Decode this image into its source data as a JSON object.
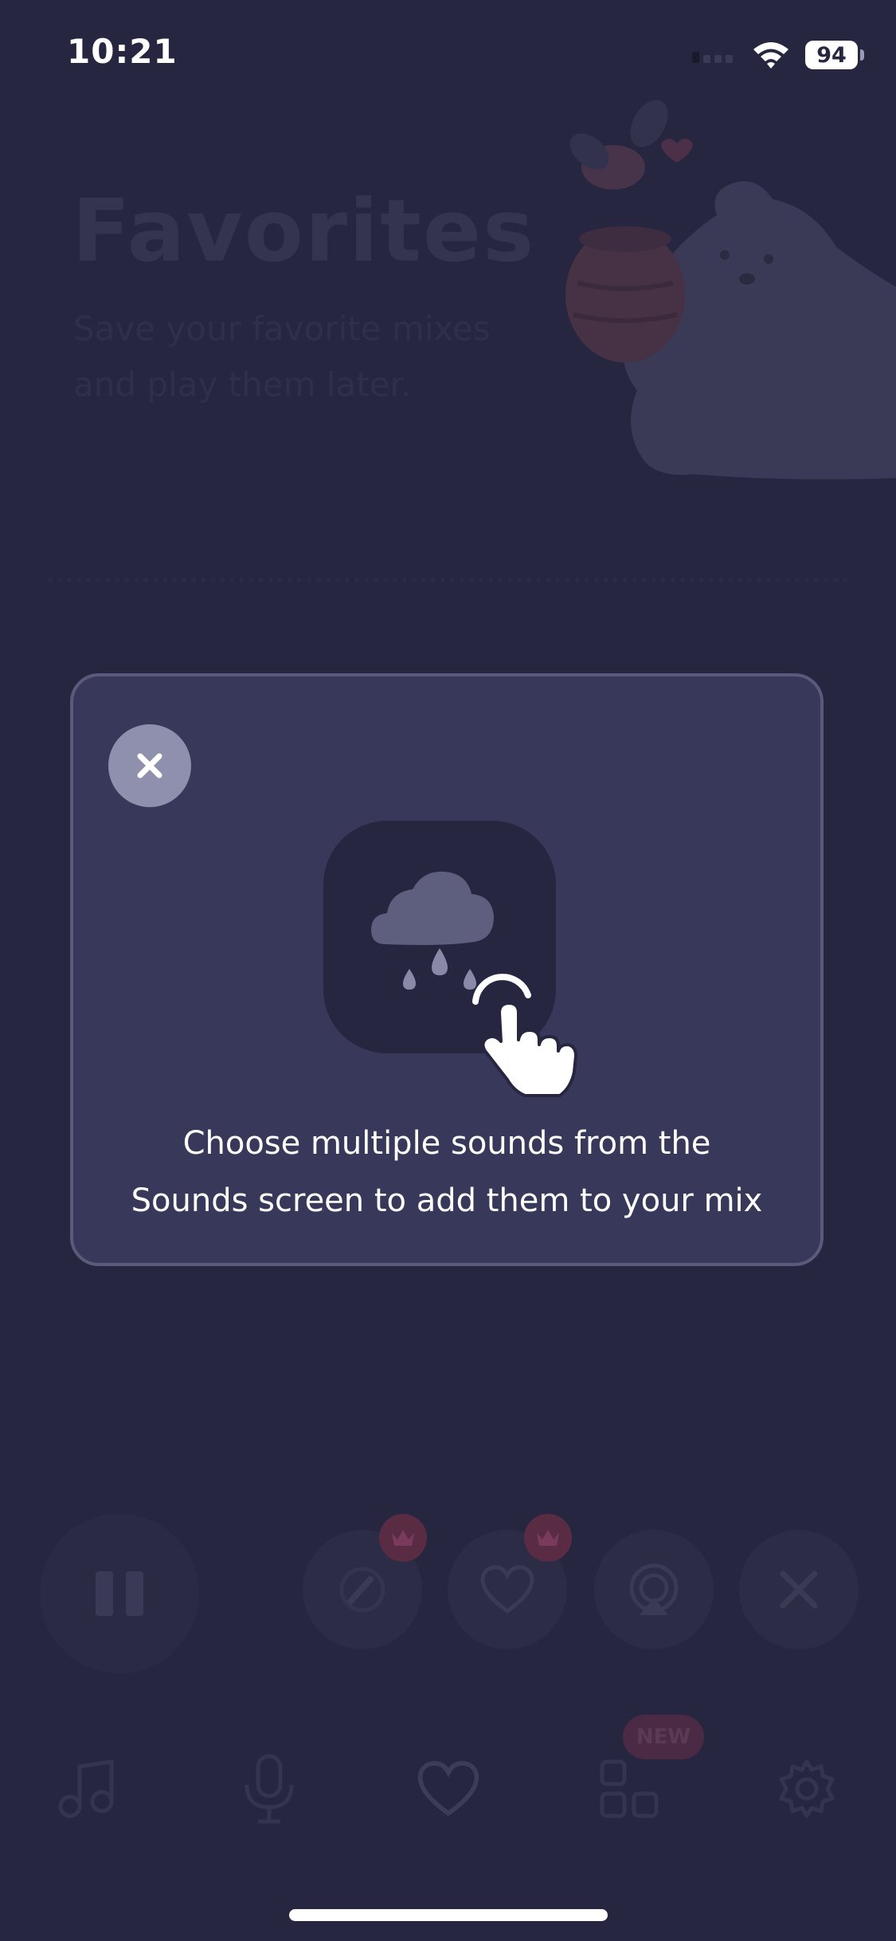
{
  "status_bar": {
    "time": "10:21",
    "battery_level": "94"
  },
  "header": {
    "title": "Favorites",
    "subtitle_line1": "Save your favorite mixes",
    "subtitle_line2": "and play them later."
  },
  "tab_bar": {
    "new_badge": "NEW"
  },
  "tip_modal": {
    "message_line1": "Choose multiple sounds from the",
    "message_line2": "Sounds screen to add them to your mix"
  },
  "colors": {
    "background": "#262640",
    "modal_background": "#38385a",
    "modal_border": "#5a5a7c",
    "close_button": "#8f8fae",
    "text": "#ffffff"
  }
}
